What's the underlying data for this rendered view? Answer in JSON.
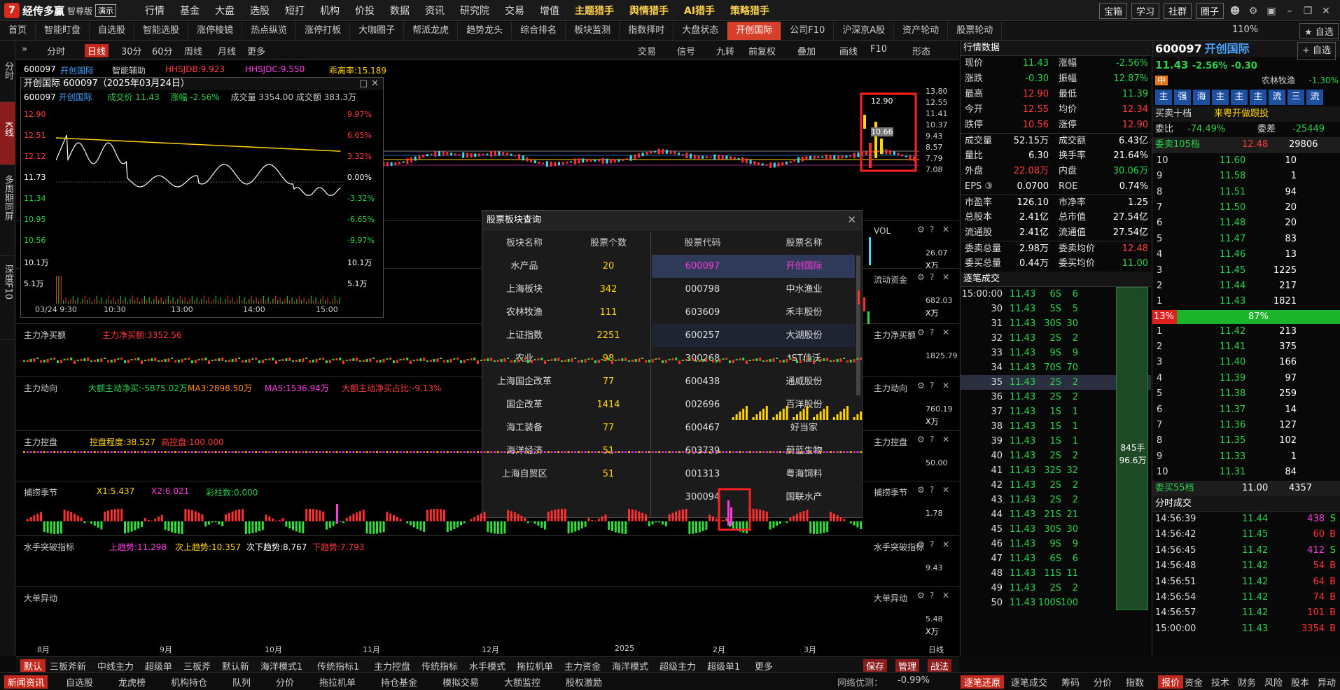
{
  "app": {
    "logo": "经传多赢",
    "edition": "智尊版",
    "demo": "演示"
  },
  "menu": [
    "行情",
    "基金",
    "大盘",
    "选股",
    "短打",
    "机构",
    "价投",
    "数据",
    "资讯",
    "研究院",
    "交易",
    "增值",
    "主题猎手",
    "舆情猎手",
    "AI猎手",
    "策略猎手"
  ],
  "top_buttons": [
    "宝箱",
    "学习",
    "社群",
    "圈子"
  ],
  "tabs": [
    "首页",
    "智能盯盘",
    "自选股",
    "智能选股",
    "涨停棱镜",
    "热点纵览",
    "涨停打板",
    "大咖圈子",
    "帮派龙虎",
    "趋势龙头",
    "综合排名",
    "板块监测",
    "指数择时",
    "大盘状态",
    "开创国际",
    "公司F10",
    "沪深京A股",
    "资产轮动",
    "股票轮动"
  ],
  "zoom": "110%",
  "self_select": "自选",
  "left_buttons": [
    "分时",
    "K线",
    "多周期同屏",
    "深度F10"
  ],
  "chart_toolbar": [
    "分时",
    "日线",
    "30分",
    "60分",
    "周线",
    "月线",
    "更多"
  ],
  "chart_toolbar_right": [
    "交易",
    "信号",
    "九转",
    "前复权",
    "叠加",
    "画线",
    "F10",
    "形态"
  ],
  "main": {
    "code": "600097",
    "name": "开创国际",
    "helper": "智能辅助",
    "ind1": "HHSJDB:9.923",
    "ind2": "HHSJDC:9.550",
    "ind3": "乖离率:15.189",
    "y_labels": [
      "13.80",
      "12.55",
      "11.41",
      "10.37",
      "9.43",
      "8.57",
      "7.79",
      "7.08"
    ],
    "price_box": [
      "12.90",
      "10.66"
    ]
  },
  "minichart": {
    "title": "开创国际 600097（2025年03月24日）",
    "code": "600097",
    "name": "开创国际",
    "price_label": "成交价 11.43",
    "change_label": "涨幅 -2.56%",
    "vol_label": "成交量 3354.00 成交额 383.3万",
    "left_axis": [
      "12.90",
      "12.51",
      "12.12",
      "11.73",
      "11.34",
      "10.95",
      "10.56",
      "10.1万",
      "5.1万"
    ],
    "right_axis": [
      "9.97%",
      "6.65%",
      "3.32%",
      "0.00%",
      "-3.32%",
      "-6.65%",
      "-9.97%",
      "10.1万",
      "5.1万"
    ],
    "time_axis": [
      "03/24 9:30",
      "10:30",
      "13:00",
      "14:00",
      "15:00"
    ]
  },
  "panels": [
    {
      "label": "VOL",
      "right": "VOL",
      "y": [
        "26.07",
        "X万"
      ]
    },
    {
      "label": "流动资金",
      "right": "流动资金",
      "y": [
        "682.03",
        "X万"
      ]
    },
    {
      "label": "主力净买额",
      "sub": "主力净买额:3352.56",
      "right": "主力净买额",
      "y": [
        "1825.79"
      ]
    },
    {
      "label": "主力动向",
      "sub1": "大额主动净买:-5875.02万",
      "sub2": "MA3:2898.50万",
      "sub3": "MA5:1536.94万",
      "sub4": "大额主动净买占比:-9.13%",
      "right": "主力动向",
      "y": [
        "760.19",
        "X万"
      ]
    },
    {
      "label": "主力控盘",
      "sub1": "控盘程度:38.527",
      "sub2": "高控盘:100.000",
      "right": "主力控盘",
      "y": [
        "50.00"
      ]
    },
    {
      "label": "捕捞季节",
      "sub1": "X1:5.437",
      "sub2": "X2:6.021",
      "sub3": "彩柱数:0.000",
      "right": "捕捞季节",
      "y": [
        "1.78"
      ]
    },
    {
      "label": "水手突破指标",
      "sub1": "上趋势:11.298",
      "sub2": "次上趋势:10.357",
      "sub3": "次下趋势:8.767",
      "sub4": "下趋势:7.793",
      "right": "水手突破指标",
      "y": [
        "9.43"
      ]
    },
    {
      "label": "大单异动",
      "right": "大单异动",
      "y": [
        "5.48",
        "X万"
      ]
    }
  ],
  "x_axis": [
    "8月",
    "9月",
    "10月",
    "11月",
    "12月",
    "2025",
    "2月",
    "3月",
    "日线"
  ],
  "bottom_tabs": [
    "默认",
    "三板斧新",
    "中线主力",
    "超级单",
    "三板斧",
    "默认新",
    "海洋模式1",
    "传统指标1",
    "主力控盘",
    "传统指标",
    "水手模式",
    "拖拉机单",
    "主力资金",
    "海洋模式",
    "超级主力",
    "超级单1",
    "更多"
  ],
  "bottom_actions": [
    "保存",
    "管理",
    "战法"
  ],
  "footer_tabs": [
    "新闻资讯",
    "自选股",
    "龙虎榜",
    "机构持仓",
    "队列",
    "分价",
    "拖拉机单",
    "持仓基金",
    "模拟交易",
    "大额监控",
    "股权激励"
  ],
  "network": "网络优测：",
  "network_val": "-0.99%",
  "footer_right_tabs": [
    "逐笔还原",
    "逐笔成交",
    "筹码",
    "分价",
    "指数",
    "报价",
    "资金",
    "技术",
    "财务",
    "风险",
    "股本",
    "异动",
    "经营"
  ],
  "dialog": {
    "title": "股票板块查询",
    "col1": "板块名称",
    "col2": "股票个数",
    "col3": "股票代码",
    "col4": "股票名称",
    "sectors": [
      [
        "水产品",
        "20"
      ],
      [
        "上海板块",
        "342"
      ],
      [
        "农林牧渔",
        "111"
      ],
      [
        "上证指数",
        "2251"
      ],
      [
        "农业",
        "98"
      ],
      [
        "上海国企改革",
        "77"
      ],
      [
        "国企改革",
        "1414"
      ],
      [
        "海工装备",
        "77"
      ],
      [
        "海洋经济",
        "51"
      ],
      [
        "上海自贸区",
        "51"
      ]
    ],
    "stocks": [
      [
        "600097",
        "开创国际"
      ],
      [
        "000798",
        "中水渔业"
      ],
      [
        "603609",
        "禾丰股份"
      ],
      [
        "600257",
        "大湖股份"
      ],
      [
        "300268",
        "*ST佳沃"
      ],
      [
        "600438",
        "通威股份"
      ],
      [
        "002696",
        "百洋股份"
      ],
      [
        "600467",
        "好当家"
      ],
      [
        "603739",
        "蔚蓝生物"
      ],
      [
        "001313",
        "粤海饲料"
      ],
      [
        "300094",
        "国联水产"
      ]
    ]
  },
  "quote": {
    "header": "行情数据",
    "rows": [
      [
        "现价",
        "11.43",
        "涨幅",
        "-2.56%"
      ],
      [
        "涨跌",
        "-0.30",
        "振幅",
        "12.87%"
      ],
      [
        "最高",
        "12.90",
        "最低",
        "11.39"
      ],
      [
        "今开",
        "12.55",
        "均价",
        "12.34"
      ],
      [
        "跌停",
        "10.56",
        "涨停",
        "12.90"
      ],
      [
        "成交量",
        "52.15万",
        "成交额",
        "6.43亿"
      ],
      [
        "量比",
        "6.30",
        "换手率",
        "21.64%"
      ],
      [
        "外盘",
        "22.08万",
        "内盘",
        "30.06万"
      ],
      [
        "EPS ③",
        "0.0700",
        "ROE",
        "0.74%"
      ],
      [
        "市盈率",
        "126.10",
        "市净率",
        "1.25"
      ],
      [
        "总股本",
        "2.41亿",
        "总市值",
        "27.54亿"
      ],
      [
        "流通股",
        "2.41亿",
        "流通值",
        "27.54亿"
      ],
      [
        "委卖总量",
        "2.98万",
        "委卖均价",
        "12.48"
      ],
      [
        "委买总量",
        "0.44万",
        "委买均价",
        "11.00"
      ]
    ]
  },
  "ticks": {
    "header": "逐笔成交",
    "rows": [
      [
        "15:00:00",
        "11.43",
        "6S",
        "6"
      ],
      [
        "30",
        "11.43",
        "5S",
        "5"
      ],
      [
        "31",
        "11.43",
        "30S",
        "30"
      ],
      [
        "32",
        "11.43",
        "2S",
        "2"
      ],
      [
        "33",
        "11.43",
        "9S",
        "9"
      ],
      [
        "34",
        "11.43",
        "70S",
        "70"
      ],
      [
        "35",
        "11.43",
        "2S",
        "2"
      ],
      [
        "36",
        "11.43",
        "2S",
        "2"
      ],
      [
        "37",
        "11.43",
        "1S",
        "1"
      ],
      [
        "38",
        "11.43",
        "1S",
        "1"
      ],
      [
        "39",
        "11.43",
        "1S",
        "1"
      ],
      [
        "40",
        "11.43",
        "2S",
        "2"
      ],
      [
        "41",
        "11.43",
        "32S",
        "32"
      ],
      [
        "42",
        "11.43",
        "2S",
        "2"
      ],
      [
        "43",
        "11.43",
        "2S",
        "2"
      ],
      [
        "44",
        "11.43",
        "21S",
        "21"
      ],
      [
        "45",
        "11.43",
        "30S",
        "30"
      ],
      [
        "46",
        "11.43",
        "9S",
        "9"
      ],
      [
        "47",
        "11.43",
        "6S",
        "6"
      ],
      [
        "48",
        "11.43",
        "11S",
        "11"
      ],
      [
        "49",
        "11.43",
        "2S",
        "2"
      ],
      [
        "50",
        "11.43",
        "100S",
        "100"
      ]
    ],
    "summary1": "845手",
    "summary2": "96.6万"
  },
  "far": {
    "code": "600097",
    "name": "开创国际",
    "self": "自选",
    "price": "11.43",
    "chg": "-2.56%",
    "chgv": "-0.30",
    "badge": "中",
    "industry": "农林牧渔",
    "industry_chg": "-1.30%",
    "tags": [
      "主",
      "强",
      "海",
      "主",
      "主",
      "主",
      "流",
      "三",
      "流"
    ],
    "level10": "买卖十档",
    "promo": "来粤开做跟投",
    "wb": "委比",
    "wb_val": "-74.49%",
    "wc": "委差",
    "wc_val": "-25449",
    "sell_total": "委卖105档",
    "sell_total_p": "12.48",
    "sell_total_v": "29806",
    "sells": [
      [
        "10",
        "11.60",
        "10"
      ],
      [
        "9",
        "11.58",
        "1"
      ],
      [
        "8",
        "11.51",
        "94"
      ],
      [
        "7",
        "11.50",
        "20"
      ],
      [
        "6",
        "11.48",
        "20"
      ],
      [
        "5",
        "11.47",
        "83"
      ],
      [
        "4",
        "11.46",
        "13"
      ],
      [
        "3",
        "11.45",
        "1225"
      ],
      [
        "2",
        "11.44",
        "217"
      ],
      [
        "1",
        "11.43",
        "1821"
      ]
    ],
    "ratio_l": "13%",
    "ratio_r": "87%",
    "buys": [
      [
        "1",
        "11.42",
        "213"
      ],
      [
        "2",
        "11.41",
        "375"
      ],
      [
        "3",
        "11.40",
        "166"
      ],
      [
        "4",
        "11.39",
        "97"
      ],
      [
        "5",
        "11.38",
        "259"
      ],
      [
        "6",
        "11.37",
        "14"
      ],
      [
        "7",
        "11.36",
        "127"
      ],
      [
        "8",
        "11.35",
        "102"
      ],
      [
        "9",
        "11.33",
        "1"
      ],
      [
        "10",
        "11.31",
        "84"
      ]
    ],
    "buy_total": "委买55档",
    "buy_total_p": "11.00",
    "buy_total_v": "4357",
    "trades_hdr": "分时成交",
    "trades": [
      [
        "14:56:39",
        "11.44",
        "438",
        "S"
      ],
      [
        "14:56:42",
        "11.45",
        "60",
        "B"
      ],
      [
        "14:56:45",
        "11.42",
        "412",
        "S"
      ],
      [
        "14:56:48",
        "11.42",
        "54",
        "B"
      ],
      [
        "14:56:51",
        "11.42",
        "64",
        "B"
      ],
      [
        "14:56:54",
        "11.42",
        "74",
        "B"
      ],
      [
        "14:56:57",
        "11.42",
        "101",
        "B"
      ],
      [
        "15:00:00",
        "11.43",
        "3354",
        "B"
      ]
    ]
  }
}
